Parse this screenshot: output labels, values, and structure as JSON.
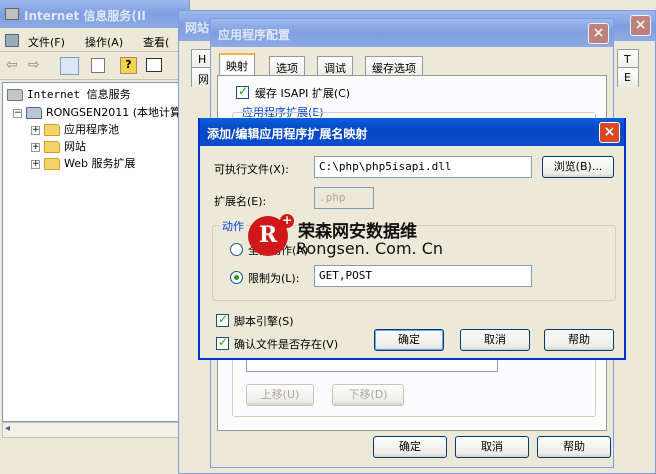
{
  "mmc": {
    "title": "Internet 信息服务(II",
    "menu": [
      "文件(F)",
      "操作(A)",
      "查看("
    ],
    "tree": {
      "root": "Internet 信息服务",
      "server": "RONGSEN2011 (本地计算机",
      "items": [
        "应用程序池",
        "网站",
        "Web 服务扩展"
      ]
    }
  },
  "site_props": {
    "title": "网站",
    "tabs_right": [
      "T",
      "E"
    ],
    "tabs_left": [
      "H",
      "网"
    ]
  },
  "app_config": {
    "title": "应用程序配置",
    "tabs": [
      "映射",
      "选项",
      "调试",
      "缓存选项"
    ],
    "cache_isapi": "缓存 ISAPI 扩展(C)",
    "group_label": "应用程序扩展(E)",
    "move_up": "上移(U)",
    "move_down": "下移(D)",
    "ok": "确定",
    "cancel": "取消",
    "help": "帮助"
  },
  "dialog": {
    "title": "添加/编辑应用程序扩展名映射",
    "exe_label": "可执行文件(X):",
    "exe_value": "C:\\php\\php5isapi.dll",
    "browse": "浏览(B)...",
    "ext_label": "扩展名(E):",
    "ext_value": ".php",
    "verbs_group": "动作",
    "all_verbs": "全部动作(A)",
    "limit_to": "限制为(L):",
    "limit_value": "GET,POST",
    "script_engine": "脚本引擎(S)",
    "verify_file": "确认文件是否存在(V)",
    "ok": "确定",
    "cancel": "取消",
    "help": "帮助"
  },
  "watermark": {
    "logo_letter": "R",
    "name": "荣森网安数据维",
    "url": "Rongsen. Com. Cn"
  },
  "colors": {
    "xp_blue": "#0846c2",
    "close_red": "#d94a24",
    "check_green": "#21a121",
    "face": "#ece9d8"
  }
}
